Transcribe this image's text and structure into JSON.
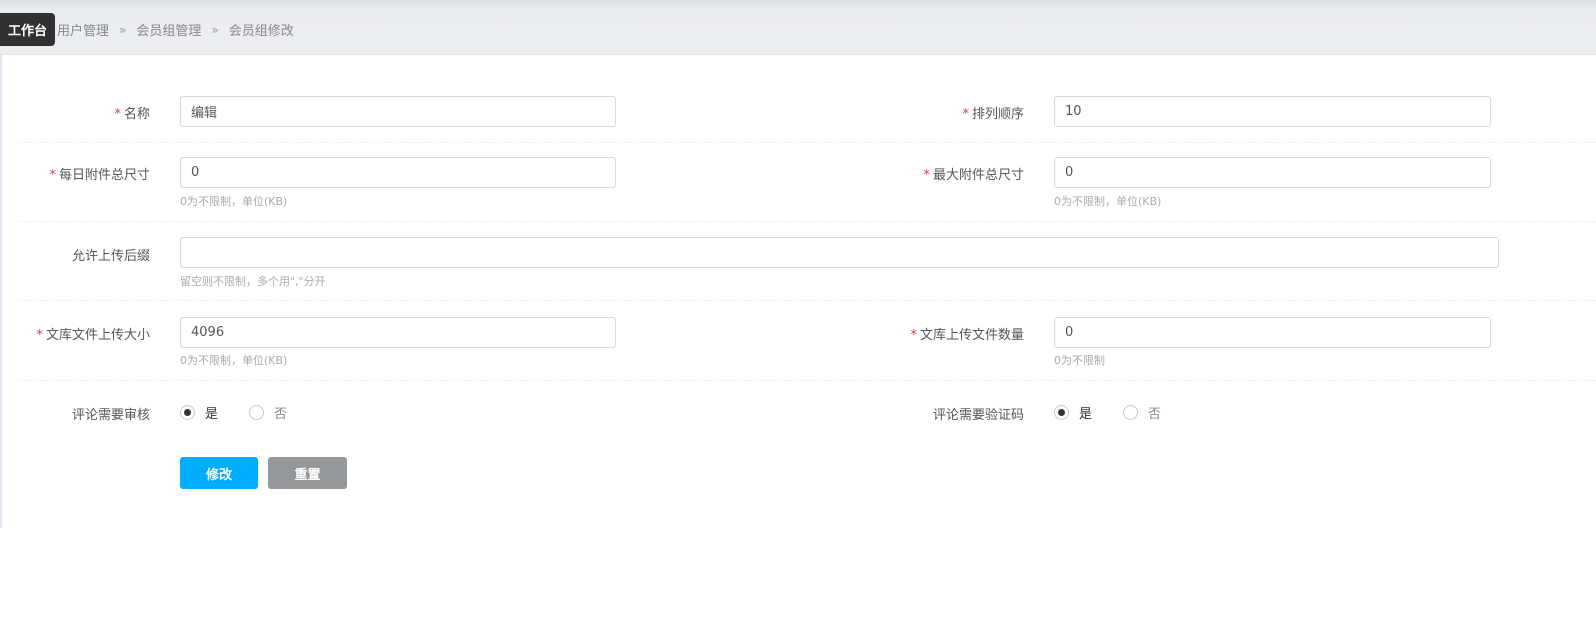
{
  "breadcrumb": [
    "用户管理",
    "会员组管理",
    "会员组修改"
  ],
  "breadcrumb_sep": "»",
  "tooltip": "工作台",
  "form": {
    "name": {
      "label": "名称",
      "value": "编辑"
    },
    "sort": {
      "label": "排列顺序",
      "value": "10"
    },
    "daily_size": {
      "label": "每日附件总尺寸",
      "value": "0",
      "hint": "0为不限制，单位(KB)"
    },
    "max_size": {
      "label": "最大附件总尺寸",
      "value": "0",
      "hint": "0为不限制，单位(KB)"
    },
    "suffix": {
      "label": "允许上传后缀",
      "value": "",
      "hint": "留空则不限制，多个用\",\"分开"
    },
    "doc_size": {
      "label": "文库文件上传大小",
      "value": "4096",
      "hint": "0为不限制，单位(KB)"
    },
    "doc_count": {
      "label": "文库上传文件数量",
      "value": "0",
      "hint": "0为不限制"
    },
    "comment_review": {
      "label": "评论需要审核",
      "options": [
        "是",
        "否"
      ],
      "selected": "是"
    },
    "comment_captcha": {
      "label": "评论需要验证码",
      "options": [
        "是",
        "否"
      ],
      "selected": "是"
    }
  },
  "buttons": {
    "submit": "修改",
    "reset": "重置"
  },
  "colors": {
    "primary": "#00aeff",
    "reset": "#94979c",
    "required": "#e4393c"
  }
}
